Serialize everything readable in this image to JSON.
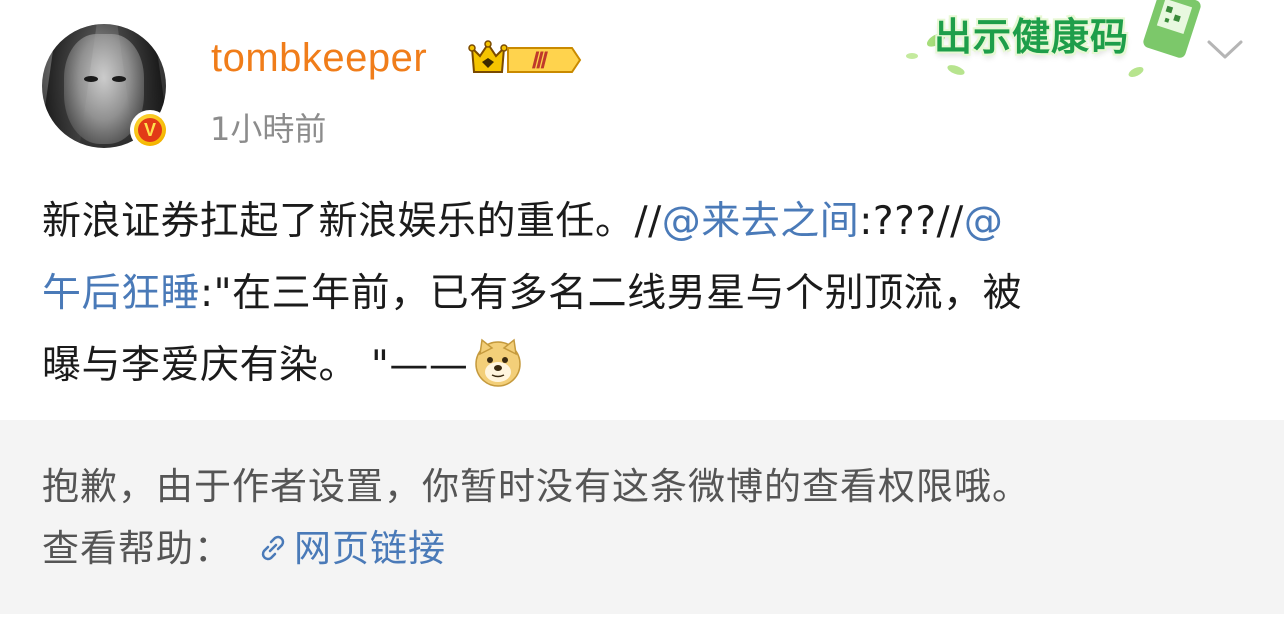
{
  "post": {
    "username": "tombkeeper",
    "level_badge": "Ⅲ",
    "timestamp": "1小時前",
    "verified_badge": "V",
    "health_banner": "出示健康码",
    "lines": {
      "l1_a": "新浪证券扛起了新浪娱乐的重任。//",
      "l1_mention": "@来去之间",
      "l1_b": ":???//",
      "l1_mention2_part": "@",
      "l2_mention2_rest": "午后狂睡",
      "l2_b": ":\"在三年前，已有多名二线男星与个别顶流，被",
      "l3_a": "曝与李爱庆有染。  \"——"
    },
    "emoji": "doge-emoji"
  },
  "notice": {
    "message": "抱歉，由于作者设置，你暂时没有这条微博的查看权限哦。",
    "help_label": "查看帮助：",
    "help_link": "网页链接"
  },
  "colors": {
    "username": "#f07d1a",
    "link": "#4a7ab8",
    "notice_bg": "#f4f4f4",
    "health_green": "#1e9e4a"
  }
}
